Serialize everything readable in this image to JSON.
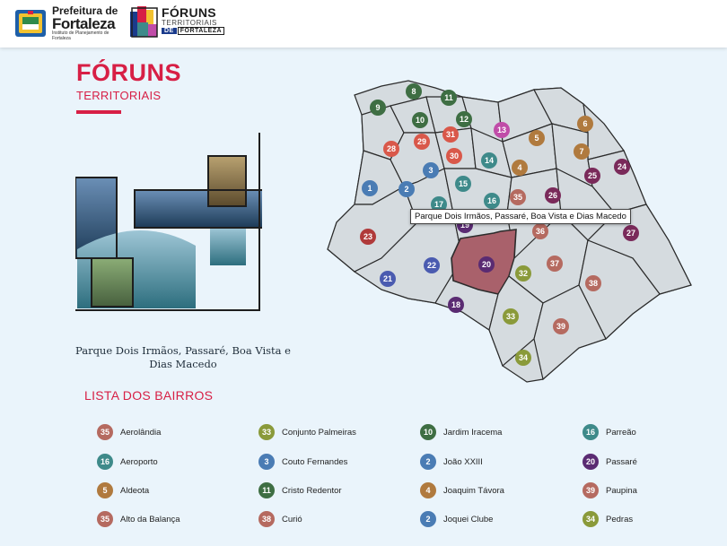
{
  "header": {
    "prefeitura": {
      "line1": "Prefeitura de",
      "line2": "Fortaleza",
      "line3": "Instituto de Planejamento de Fortaleza"
    },
    "foruns": {
      "line1": "FÓRUNS",
      "line2": "TERRITORIAIS",
      "line3_de": "DE",
      "line3_city": "FORTALEZA"
    }
  },
  "page": {
    "title": "FÓRUNS",
    "subtitle": "TERRITORIAIS"
  },
  "caption": "Parque Dois Irmãos, Passaré, Boa Vista e Dias Macedo",
  "tooltip": "Parque Dois Irmãos, Passaré, Boa Vista e Dias Macedo",
  "list_title": "LISTA DOS BAIRROS",
  "colors": {
    "accent": "#d71f45",
    "highlight": "#a9616b",
    "map_fill": "#d5dbdf"
  },
  "territory_colors": {
    "1": "#4a7cb4",
    "2": "#4a7cb4",
    "3": "#4a7cb4",
    "4": "#b07a3e",
    "5": "#b07a3e",
    "6": "#b07a3e",
    "7": "#b07a3e",
    "8": "#3e6e43",
    "9": "#3e6e43",
    "10": "#3e6e43",
    "11": "#3e6e43",
    "12": "#3e6e43",
    "13": "#c04ca8",
    "14": "#3e8a8a",
    "15": "#3e8a8a",
    "16": "#3e8a8a",
    "17": "#3e8a8a",
    "20": "#5a2b72",
    "21": "#4a5bb0",
    "22": "#4a5bb0",
    "23": "#b03a3a",
    "24": "#7a2a5a",
    "25": "#7a2a5a",
    "26": "#7a2a5a",
    "27": "#7a2a5a",
    "28": "#d9584a",
    "29": "#d9584a",
    "30": "#d9584a",
    "31": "#d9584a",
    "32": "#8a9a3a",
    "33": "#8a9a3a",
    "34": "#8a9a3a",
    "35": "#b56a60",
    "36": "#b56a60",
    "37": "#b56a60",
    "38": "#b56a60",
    "39": "#b56a60",
    "18": "#5a2b72",
    "19": "#5a2b72"
  },
  "map_markers": [
    {
      "n": "8"
    },
    {
      "n": "11"
    },
    {
      "n": "9"
    },
    {
      "n": "10"
    },
    {
      "n": "12"
    },
    {
      "n": "13"
    },
    {
      "n": "6"
    },
    {
      "n": "5"
    },
    {
      "n": "28"
    },
    {
      "n": "29"
    },
    {
      "n": "31"
    },
    {
      "n": "30"
    },
    {
      "n": "14"
    },
    {
      "n": "4"
    },
    {
      "n": "7"
    },
    {
      "n": "25"
    },
    {
      "n": "24"
    },
    {
      "n": "3"
    },
    {
      "n": "15"
    },
    {
      "n": "1"
    },
    {
      "n": "2"
    },
    {
      "n": "17"
    },
    {
      "n": "16"
    },
    {
      "n": "35"
    },
    {
      "n": "26"
    },
    {
      "n": "19"
    },
    {
      "n": "36"
    },
    {
      "n": "27"
    },
    {
      "n": "23"
    },
    {
      "n": "22"
    },
    {
      "n": "20"
    },
    {
      "n": "37"
    },
    {
      "n": "32"
    },
    {
      "n": "21"
    },
    {
      "n": "38"
    },
    {
      "n": "18"
    },
    {
      "n": "33"
    },
    {
      "n": "39"
    },
    {
      "n": "34"
    }
  ],
  "bairros": [
    {
      "n": "35",
      "name": "Aerolândia"
    },
    {
      "n": "16",
      "name": "Aeroporto"
    },
    {
      "n": "5",
      "name": "Aldeota"
    },
    {
      "n": "35",
      "name": "Alto da Balança"
    },
    {
      "n": "33",
      "name": "Conjunto Palmeiras"
    },
    {
      "n": "3",
      "name": "Couto Fernandes"
    },
    {
      "n": "11",
      "name": "Cristo Redentor"
    },
    {
      "n": "38",
      "name": "Curió"
    },
    {
      "n": "10",
      "name": "Jardim Iracema"
    },
    {
      "n": "2",
      "name": "João XXIII"
    },
    {
      "n": "4",
      "name": "Joaquim Távora"
    },
    {
      "n": "2",
      "name": "Joquei Clube"
    },
    {
      "n": "16",
      "name": "Parreão"
    },
    {
      "n": "20",
      "name": "Passaré"
    },
    {
      "n": "39",
      "name": "Paupina"
    },
    {
      "n": "34",
      "name": "Pedras"
    }
  ]
}
